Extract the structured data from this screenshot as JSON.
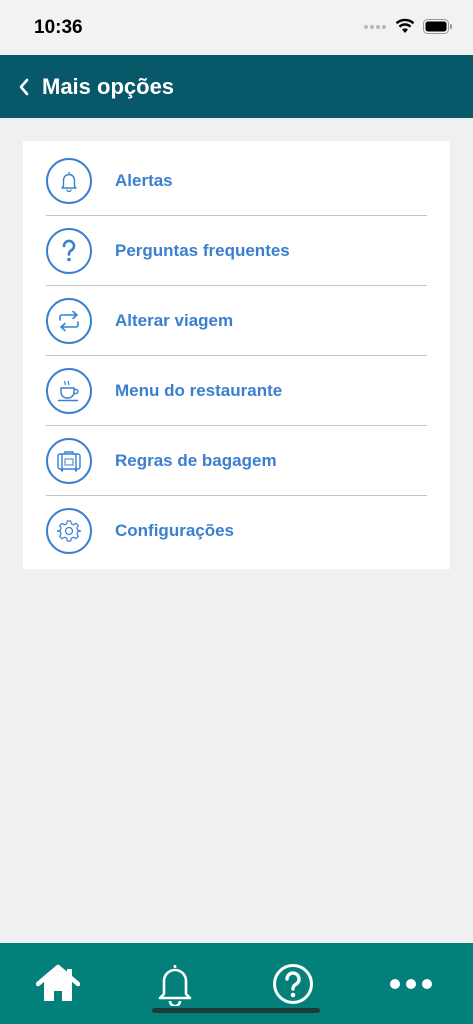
{
  "status_bar": {
    "time": "10:36"
  },
  "header": {
    "title": "Mais opções"
  },
  "menu": {
    "items": [
      {
        "label": "Alertas",
        "icon": "bell-icon"
      },
      {
        "label": "Perguntas frequentes",
        "icon": "question-icon"
      },
      {
        "label": "Alterar viagem",
        "icon": "swap-arrows-icon"
      },
      {
        "label": "Menu do restaurante",
        "icon": "coffee-cup-icon"
      },
      {
        "label": "Regras de bagagem",
        "icon": "luggage-icon"
      },
      {
        "label": "Configurações",
        "icon": "gear-icon"
      }
    ]
  },
  "tab_bar": {
    "tabs": [
      {
        "icon": "home-icon"
      },
      {
        "icon": "bell-icon"
      },
      {
        "icon": "question-icon"
      },
      {
        "icon": "more-icon"
      }
    ]
  },
  "colors": {
    "header_bg": "#07596a",
    "tab_bar_bg": "#04807a",
    "accent_blue": "#3a7fd0",
    "page_bg": "#f0f0f0"
  }
}
